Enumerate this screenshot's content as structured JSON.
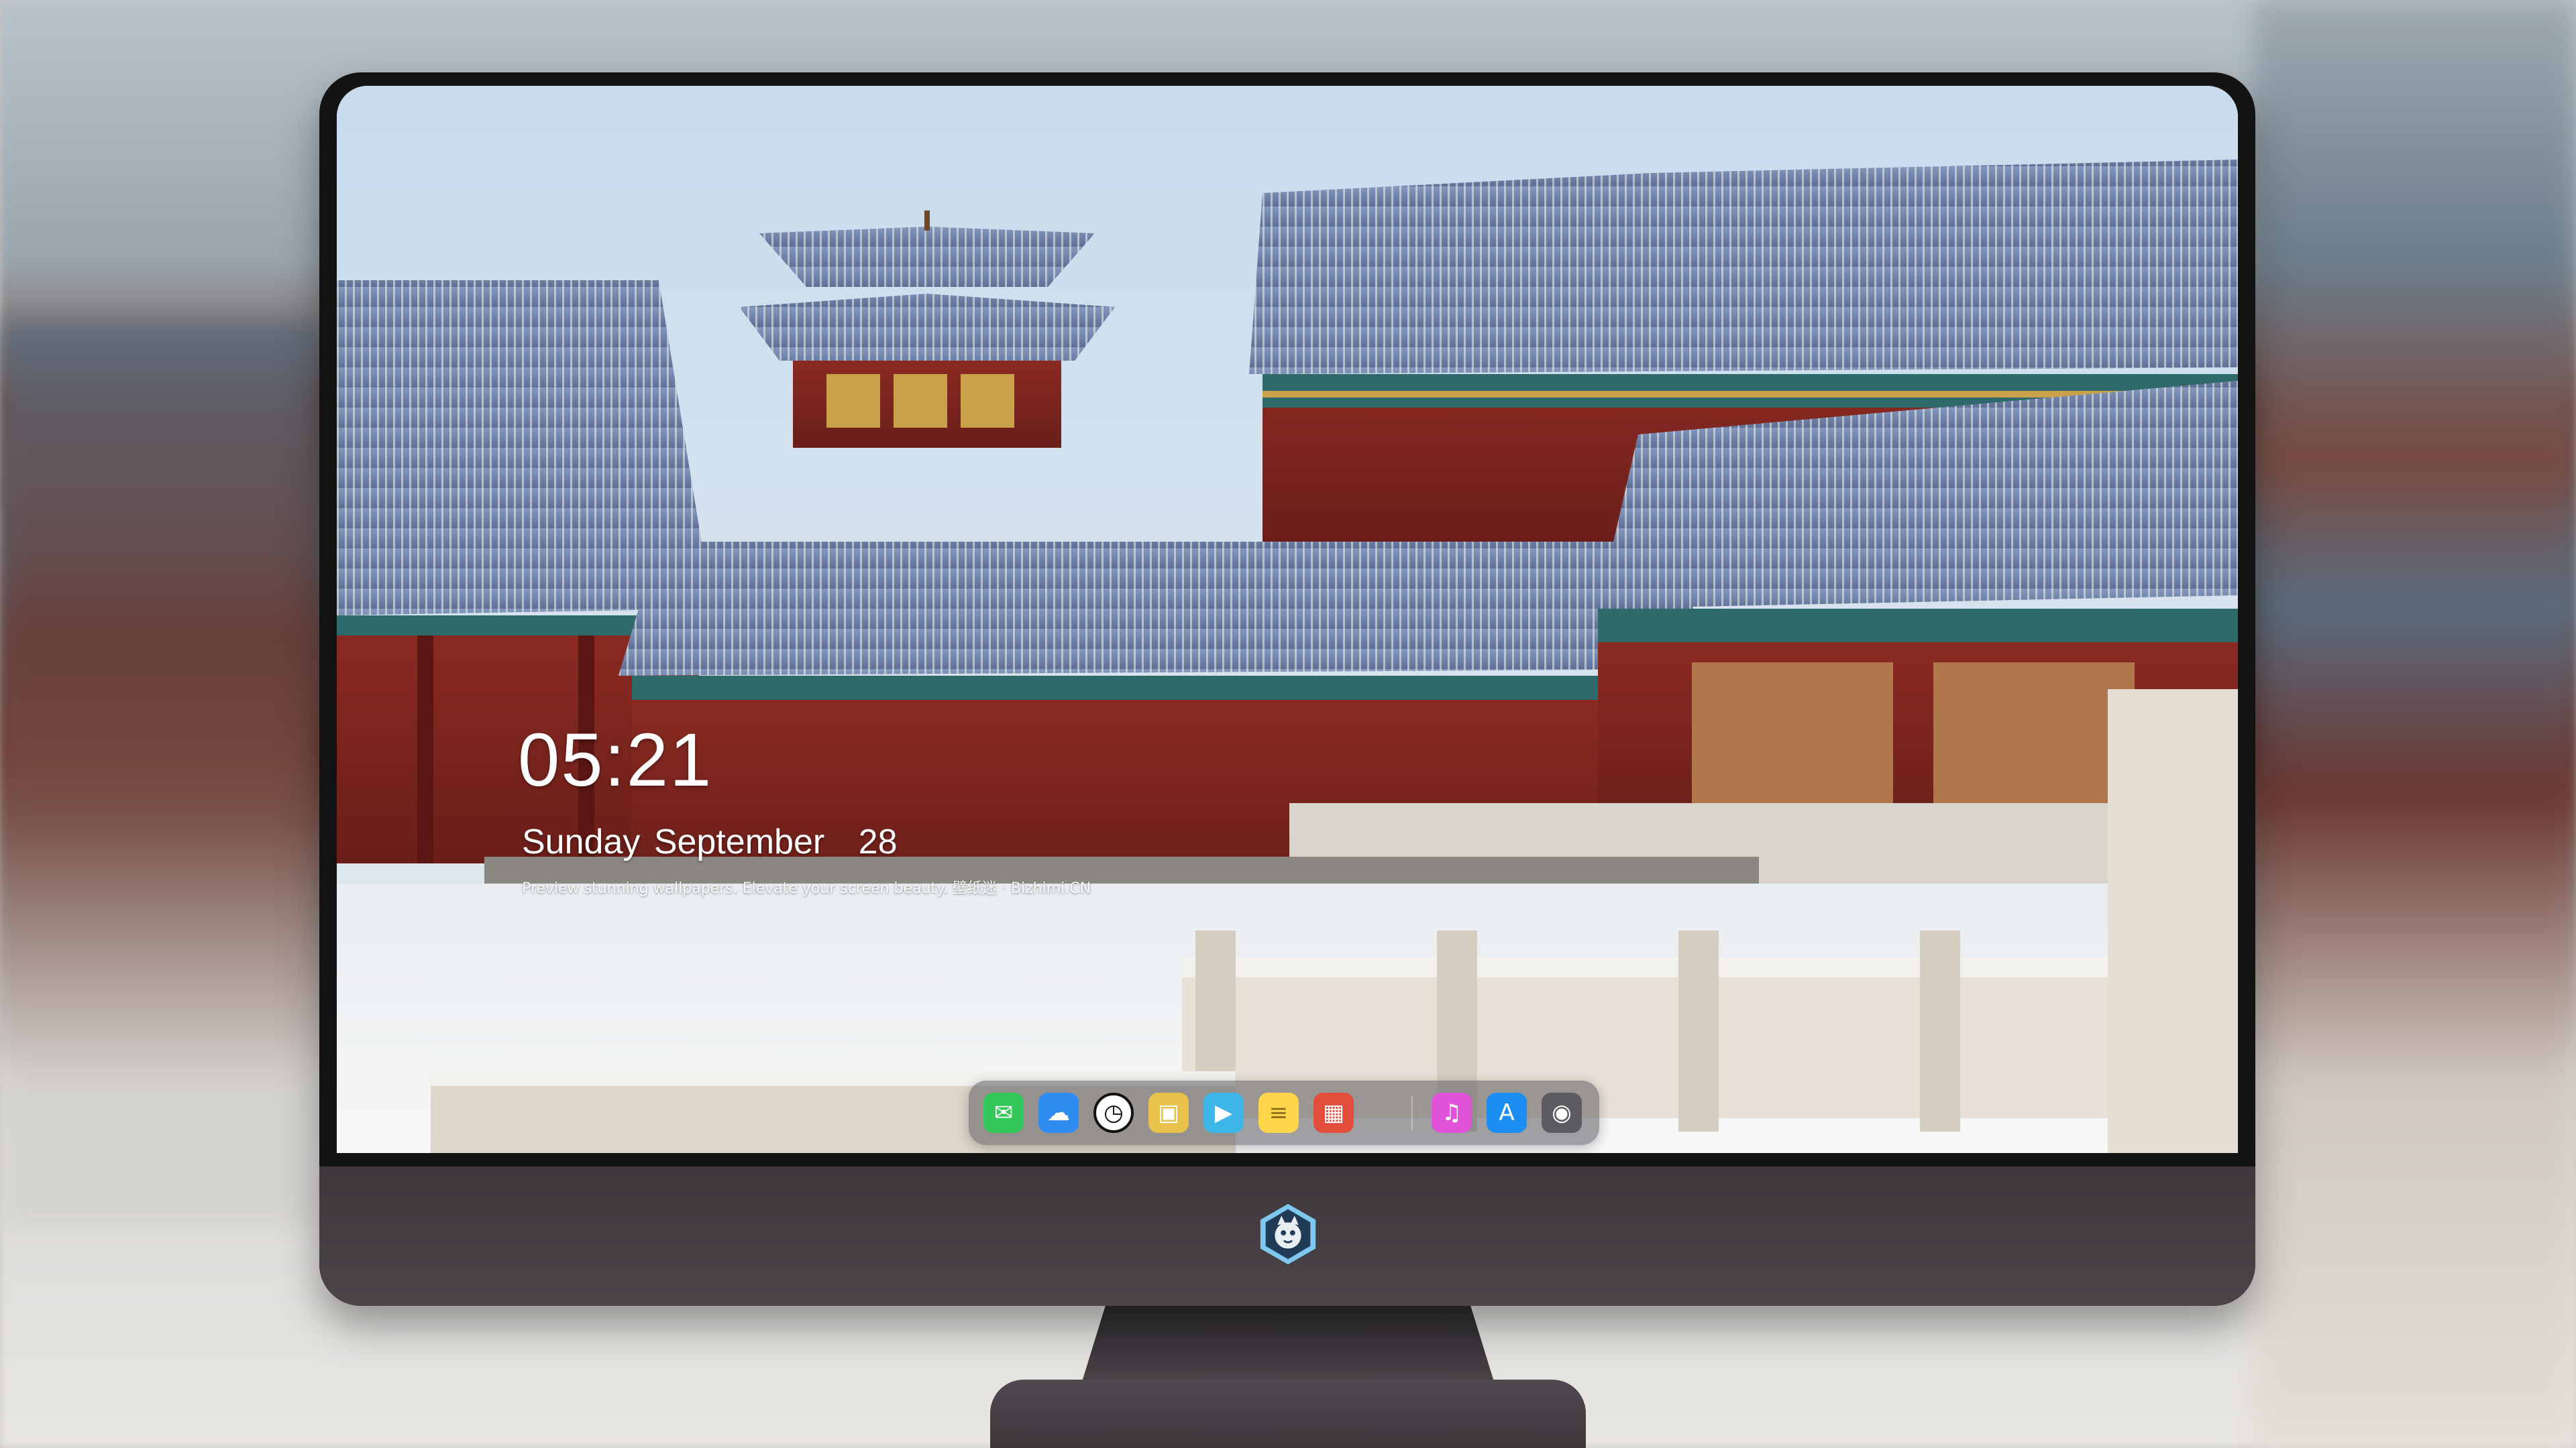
{
  "lock_screen": {
    "time": "05:21",
    "weekday": "Sunday",
    "month": "September",
    "day": "28",
    "tagline": "Preview stunning wallpapers. Elevate your screen beauty. 壁纸迷 · Bizhimi.CN"
  },
  "dock": {
    "apps": [
      {
        "name": "Messages",
        "icon": "messages-icon",
        "color": "#34c759"
      },
      {
        "name": "Weather",
        "icon": "weather-icon",
        "color": "#2f8cf0"
      },
      {
        "name": "Clock",
        "icon": "clock-icon",
        "color": "#111111"
      },
      {
        "name": "Preview",
        "icon": "preview-icon",
        "color": "#e8c24a"
      },
      {
        "name": "Clips",
        "icon": "clips-icon",
        "color": "#3fb6e8"
      },
      {
        "name": "Notes",
        "icon": "notes-icon",
        "color": "#ffd54a"
      },
      {
        "name": "Photo Booth",
        "icon": "photo-booth-icon",
        "color": "#e34d3c"
      },
      {
        "name": "Music",
        "icon": "music-icon",
        "color": "#e052d8"
      },
      {
        "name": "App Store",
        "icon": "app-store-icon",
        "color": "#1c8ef2"
      },
      {
        "name": "Camera",
        "icon": "camera-icon",
        "color": "#5b5b60"
      }
    ]
  },
  "colors": {
    "bezel": "#141314",
    "chin": "#463f44",
    "palace_red": "#8c2a22",
    "roof_blue": "#6f86ae",
    "snow": "#f1f3f5"
  }
}
